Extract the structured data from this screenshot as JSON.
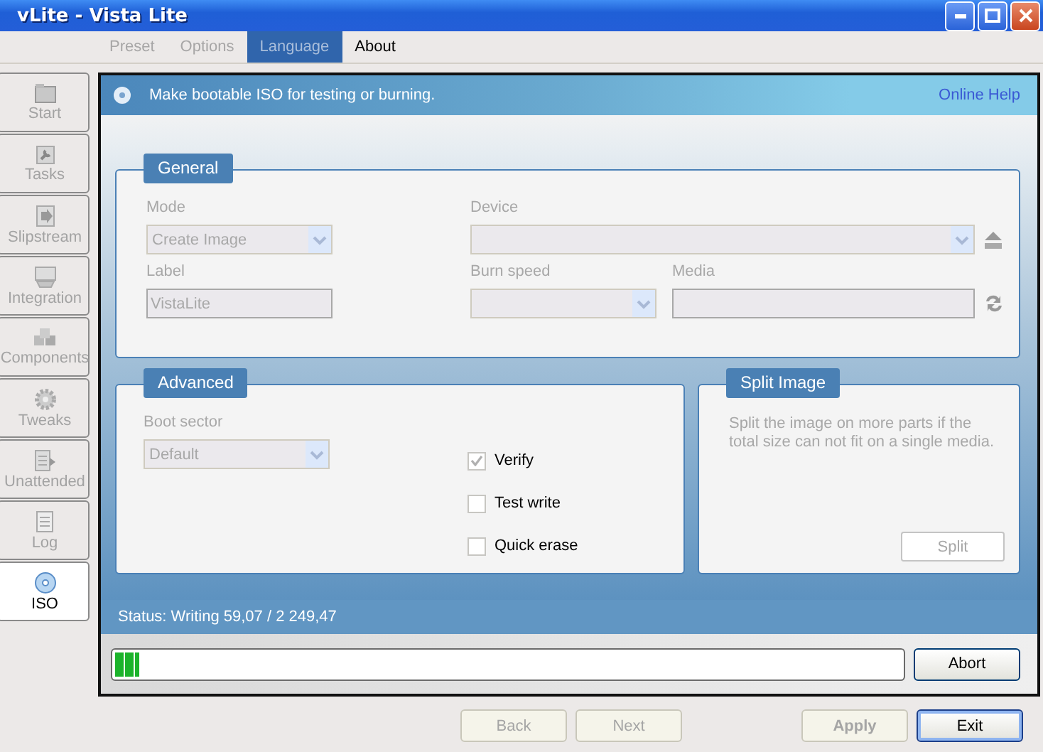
{
  "window": {
    "title": "vLite - Vista Lite"
  },
  "menu_tabs": [
    {
      "label": "Preset",
      "selected": false,
      "disabled": true
    },
    {
      "label": "Options",
      "selected": false,
      "disabled": true
    },
    {
      "label": "Language",
      "selected": true,
      "disabled": false
    },
    {
      "label": "About",
      "selected": false,
      "disabled": false
    }
  ],
  "sidebar": {
    "items": [
      {
        "label": "Start",
        "selected": false,
        "disabled": true
      },
      {
        "label": "Tasks",
        "selected": false,
        "disabled": true
      },
      {
        "label": "Slipstream",
        "selected": false,
        "disabled": true
      },
      {
        "label": "Integration",
        "selected": false,
        "disabled": true
      },
      {
        "label": "Components",
        "selected": false,
        "disabled": true
      },
      {
        "label": "Tweaks",
        "selected": false,
        "disabled": true
      },
      {
        "label": "Unattended",
        "selected": false,
        "disabled": true
      },
      {
        "label": "Log",
        "selected": false,
        "disabled": true
      },
      {
        "label": "ISO",
        "selected": true,
        "disabled": false
      }
    ]
  },
  "header": {
    "text": "Make bootable ISO for testing or burning.",
    "link": "Online Help"
  },
  "general": {
    "title": "General",
    "mode_label": "Mode",
    "mode_value": "Create Image",
    "device_label": "Device",
    "label_label": "Label",
    "label_value": "VistaLite",
    "burn_speed_label": "Burn speed",
    "media_label": "Media"
  },
  "advanced": {
    "title": "Advanced",
    "boot_sector_label": "Boot sector",
    "boot_sector_value": "Default",
    "options": [
      {
        "label": "Verify",
        "checked": true
      },
      {
        "label": "Test write",
        "checked": false
      },
      {
        "label": "Quick erase",
        "checked": false
      }
    ]
  },
  "split": {
    "title": "Split Image",
    "description": "Split the image on more parts if the total size can not fit on a single media.",
    "button": "Split"
  },
  "status": "Status: Writing 59,07 / 2 249,47",
  "progress": {
    "level": 0.03
  },
  "abort_button": "Abort",
  "footer_buttons": [
    {
      "label": "Back",
      "disabled": true,
      "default": false,
      "bold": false
    },
    {
      "label": "Next",
      "disabled": true,
      "default": false,
      "bold": false
    },
    {
      "label": "Apply",
      "disabled": true,
      "default": false,
      "bold": true
    },
    {
      "label": "Exit",
      "disabled": false,
      "default": true,
      "bold": false
    }
  ]
}
